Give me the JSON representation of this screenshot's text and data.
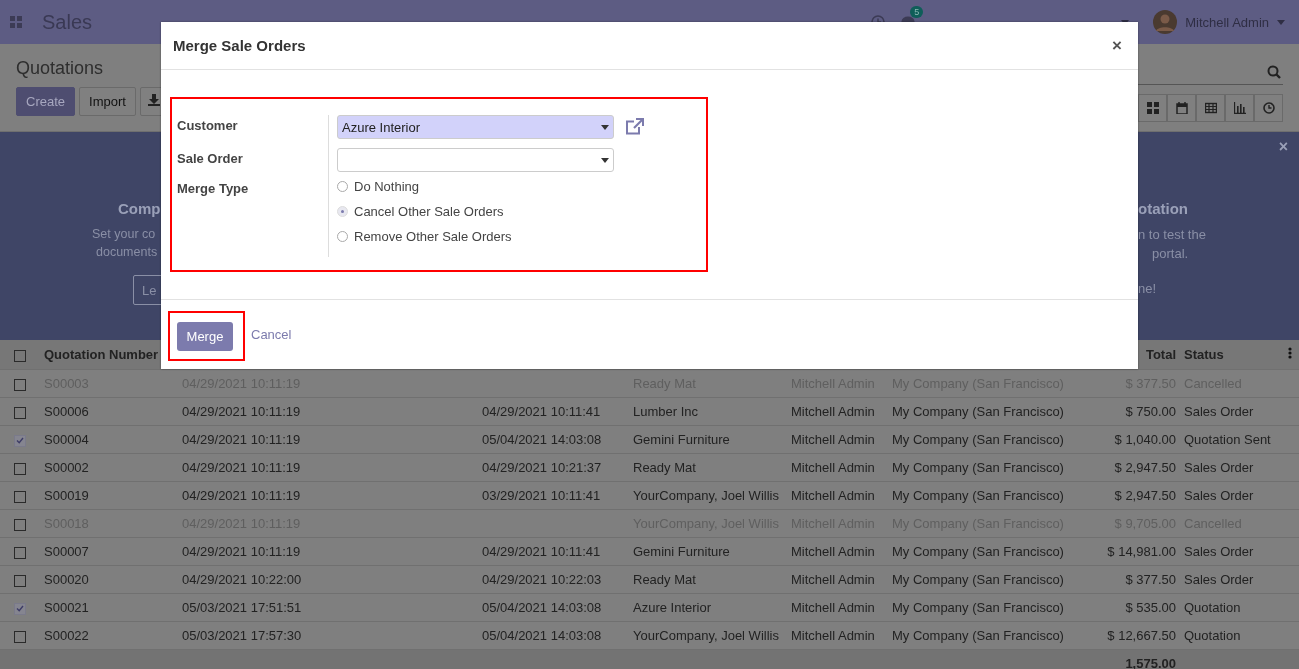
{
  "navbar": {
    "app": "Sales",
    "chat_badge": "5",
    "user": "Mitchell Admin"
  },
  "control_panel": {
    "breadcrumb": "Quotations",
    "buttons": [
      "Create",
      "Import"
    ]
  },
  "banner": {
    "left_title": "Comp",
    "left_lines": [
      "Set your co",
      "documents"
    ],
    "left_button": "Le",
    "right_title": "otation",
    "right_lines": [
      "n to test the",
      "portal."
    ],
    "right_note": "ne!"
  },
  "table": {
    "all_selected": false,
    "columns": [
      "Quotation Number",
      "Total",
      "Status"
    ],
    "rows": [
      {
        "checked": false,
        "cancelled": true,
        "number": "S00003",
        "date": "04/29/2021 10:11:19",
        "customer": "Ready Mat",
        "salesperson": "Mitchell Admin",
        "company": "My Company (San Francisco)",
        "total": "$ 377.50",
        "status": "Cancelled"
      },
      {
        "checked": false,
        "cancelled": false,
        "number": "S00006",
        "date": "04/29/2021 10:11:19",
        "expected_date": "04/29/2021 10:11:41",
        "customer": "Lumber Inc",
        "salesperson": "Mitchell Admin",
        "company": "My Company (San Francisco)",
        "total": "$ 750.00",
        "status": "Sales Order"
      },
      {
        "checked": true,
        "cancelled": false,
        "number": "S00004",
        "date": "04/29/2021 10:11:19",
        "expected_date": "05/04/2021 14:03:08",
        "customer": "Gemini Furniture",
        "salesperson": "Mitchell Admin",
        "company": "My Company (San Francisco)",
        "total": "$ 1,040.00",
        "status": "Quotation Sent"
      },
      {
        "checked": false,
        "cancelled": false,
        "number": "S00002",
        "date": "04/29/2021 10:11:19",
        "expected_date": "04/29/2021 10:21:37",
        "customer": "Ready Mat",
        "salesperson": "Mitchell Admin",
        "company": "My Company (San Francisco)",
        "total": "$ 2,947.50",
        "status": "Sales Order"
      },
      {
        "checked": false,
        "cancelled": false,
        "number": "S00019",
        "date": "04/29/2021 10:11:19",
        "expected_date": "03/29/2021 10:11:41",
        "customer": "YourCompany, Joel Willis",
        "salesperson": "Mitchell Admin",
        "company": "My Company (San Francisco)",
        "total": "$ 2,947.50",
        "status": "Sales Order"
      },
      {
        "checked": false,
        "cancelled": true,
        "number": "S00018",
        "date": "04/29/2021 10:11:19",
        "customer": "YourCompany, Joel Willis",
        "salesperson": "Mitchell Admin",
        "company": "My Company (San Francisco)",
        "total": "$ 9,705.00",
        "status": "Cancelled"
      },
      {
        "checked": false,
        "cancelled": false,
        "number": "S00007",
        "date": "04/29/2021 10:11:19",
        "expected_date": "04/29/2021 10:11:41",
        "customer": "Gemini Furniture",
        "salesperson": "Mitchell Admin",
        "company": "My Company (San Francisco)",
        "total": "$ 14,981.00",
        "status": "Sales Order"
      },
      {
        "checked": false,
        "cancelled": false,
        "number": "S00020",
        "date": "04/29/2021 10:22:00",
        "expected_date": "04/29/2021 10:22:03",
        "customer": "Ready Mat",
        "salesperson": "Mitchell Admin",
        "company": "My Company (San Francisco)",
        "total": "$ 377.50",
        "status": "Sales Order"
      },
      {
        "checked": true,
        "cancelled": false,
        "number": "S00021",
        "date": "05/03/2021 17:51:51",
        "expected_date": "05/04/2021 14:03:08",
        "customer": "Azure Interior",
        "salesperson": "Mitchell Admin",
        "company": "My Company (San Francisco)",
        "total": "$ 535.00",
        "status": "Quotation"
      },
      {
        "checked": false,
        "cancelled": false,
        "number": "S00022",
        "date": "05/03/2021 17:57:30",
        "expected_date": "05/04/2021 14:03:08",
        "customer": "YourCompany, Joel Willis",
        "salesperson": "Mitchell Admin",
        "company": "My Company (San Francisco)",
        "total": "$ 12,667.50",
        "status": "Quotation"
      }
    ],
    "footer_total": "1,575.00"
  },
  "dialog": {
    "title": "Merge Sale Orders",
    "close": "×",
    "fields": [
      {
        "kind": "select",
        "label": "Customer",
        "value": "Azure Interior",
        "highlighted": true,
        "external_link": true
      },
      {
        "kind": "select",
        "label": "Sale Order",
        "highlighted": false,
        "external_link": false
      },
      {
        "kind": "radio",
        "label": "Merge Type",
        "options": [
          {
            "label": "Do Nothing",
            "selected": false
          },
          {
            "label": "Cancel Other Sale Orders",
            "selected": true
          },
          {
            "label": "Remove Other Sale Orders",
            "selected": false
          }
        ]
      }
    ],
    "primary_button": "Merge",
    "cancel_link": "Cancel"
  }
}
